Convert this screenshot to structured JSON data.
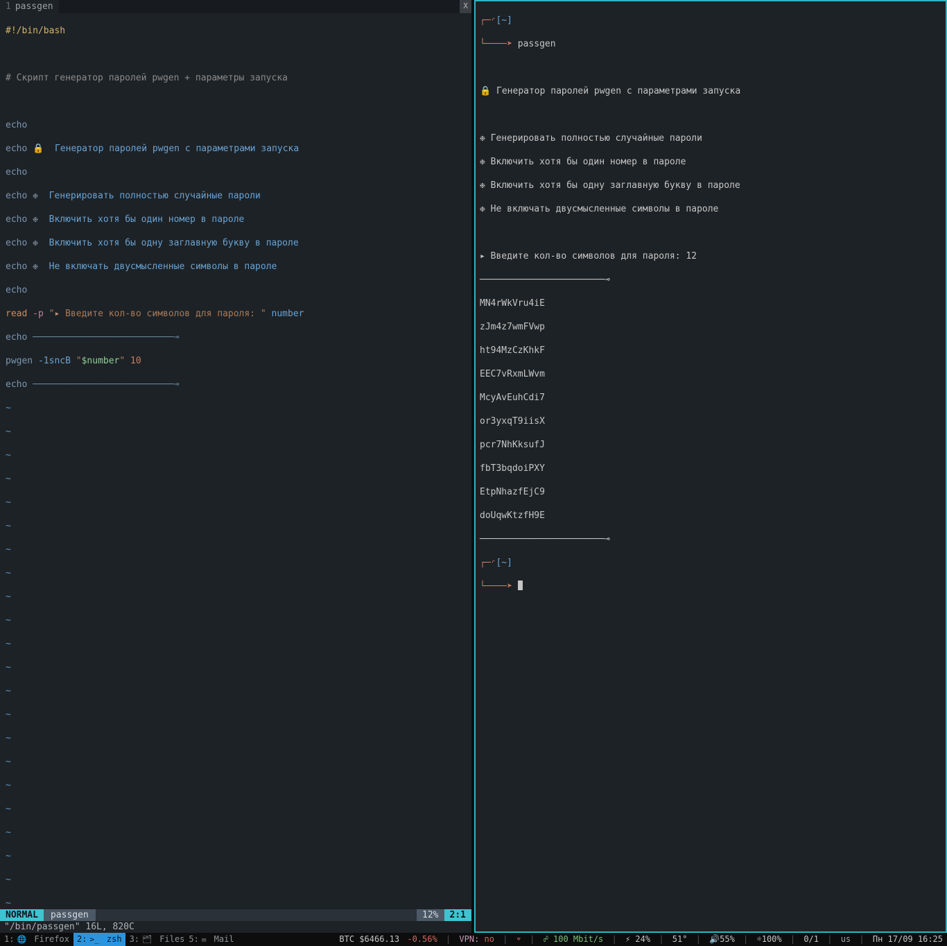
{
  "editor": {
    "tab": {
      "index": "1",
      "filename": "passgen",
      "close": "X"
    },
    "lines": {
      "shebang": "#!/bin/bash",
      "comment": "# Скрипт генератор паролей pwgen + параметры запуска",
      "echo": "echo",
      "lock": "🔒",
      "title": "  Генератор паролей pwgen с параметрами запуска",
      "star": "❉",
      "opt1": "  Генерировать полностью случайные пароли",
      "opt2": "  Включить хотя бы один номер в пароле",
      "opt3": "  Включить хотя бы одну заглавную букву в пароле",
      "opt4": "  Не включать двусмысленные символы в пароле",
      "read": "read",
      "read_flag": "-p",
      "read_q1": "\"",
      "read_arrow": "▸",
      "read_text": " Введите кол-во символов для пароля: ",
      "read_q2": "\"",
      "read_var": " number",
      "sep": "──────────────────────────⊸",
      "pwgen_cmd": "pwgen",
      "pwgen_flags": " -1sncB ",
      "pwgen_q": "\"",
      "pwgen_var": "$number",
      "pwgen_num": " 10"
    },
    "tilde": "~",
    "status": {
      "mode": "NORMAL",
      "file": "passgen",
      "percent": "12%",
      "pos": "2:1"
    },
    "cmdline": "\"/bin/passgen\" 16L, 820C"
  },
  "terminal": {
    "prompt_open": "┌─◜",
    "prompt_cwd": "[~]",
    "prompt_line2": "└────➤ ",
    "cmd": "passgen",
    "lock": "🔒",
    "title": " Генератор паролей pwgen с параметрами запуска",
    "star": "❉",
    "opt1": " Генерировать полностью случайные пароли",
    "opt2": " Включить хотя бы один номер в пароле",
    "opt3": " Включить хотя бы одну заглавную букву в пароле",
    "opt4": " Не включать двусмысленные символы в пароле",
    "arrow": "▸",
    "input_prompt": " Введите кол-во символов для пароля: ",
    "input_value": "12",
    "sep": "───────────────────────⊸",
    "passwords": [
      "MN4rWkVru4iE",
      "zJm4z7wmFVwp",
      "ht94MzCzKhkF",
      "EEC7vRxmLWvm",
      "McyAvEuhCdi7",
      "or3yxqT9iisX",
      "pcr7NhKksufJ",
      "fbT3bqdoiPXY",
      "EtpNhazfEjC9",
      "doUqwKtzfH9E"
    ]
  },
  "bottombar": {
    "ws": [
      {
        "n": "1:",
        "icon": "🌐",
        "label": " Firefox"
      },
      {
        "n": "2:",
        "icon": ">_",
        "label": " zsh"
      },
      {
        "n": "3:",
        "icon": "🗂",
        "label": " Files"
      },
      {
        "n": "5:",
        "icon": "✉",
        "label": " Mail"
      }
    ],
    "btc": "BTC $6466.13",
    "btc_change": " -0.56%",
    "vpn_label": "VPN: ",
    "vpn_value": "no",
    "wifi": "⌔",
    "net": "☍ 100 Mbit/s",
    "cpu_icon": "⚡",
    "cpu": " 24%",
    "temp": "51°",
    "vol_icon": "🔊",
    "vol": "55%",
    "bat_icon": "☼",
    "bat": "100%",
    "updown": "0/1",
    "kbd": "us",
    "date": "Пн 17/09 16:25",
    "pipe": " | "
  }
}
